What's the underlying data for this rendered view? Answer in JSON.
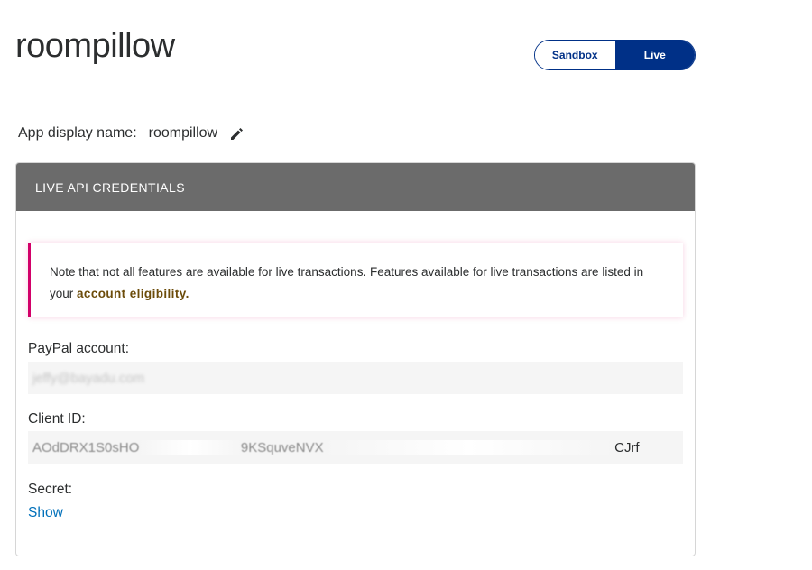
{
  "header": {
    "app_title": "roompillow",
    "env_toggle": {
      "sandbox_label": "Sandbox",
      "live_label": "Live",
      "selected": "Live"
    }
  },
  "display_name": {
    "label": "App display name:",
    "value": "roompillow"
  },
  "credentials": {
    "title": "LIVE API CREDENTIALS",
    "note": {
      "text": "Note that not all features are available for live transactions. Features available for live transactions are listed in your ",
      "link_label": "account eligibility."
    },
    "paypal_account": {
      "label": "PayPal account:",
      "value": "jeffy@bayadu.com"
    },
    "client_id": {
      "label": "Client ID:",
      "value_start": "AOdDRX1S0sHO",
      "value_mid": "9KSquveNVX",
      "value_end": "CJrf"
    },
    "secret": {
      "label": "Secret:",
      "show_label": "Show"
    }
  },
  "colors": {
    "brand": "#003087",
    "header_bg": "#6b6b6b",
    "note_accent": "#d20069",
    "link": "#0070ba",
    "eligibility_link": "#6c4c0a"
  }
}
